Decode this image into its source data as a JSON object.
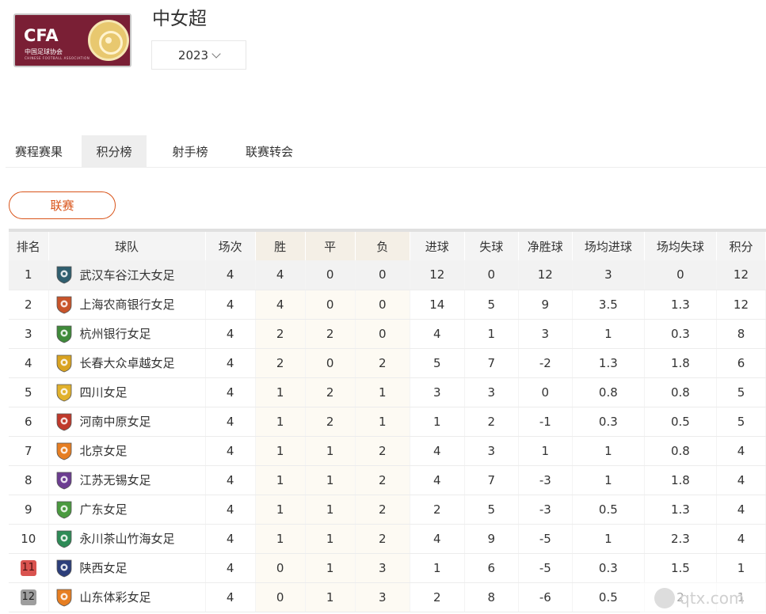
{
  "header": {
    "logo_text": "CFA",
    "logo_sub": "中国足球协会",
    "logo_sub_en": "CHINESE FOOTBALL ASSOCIATION",
    "title": "中女超",
    "season": "2023"
  },
  "tabs": [
    {
      "label": "赛程赛果",
      "active": false
    },
    {
      "label": "积分榜",
      "active": true
    },
    {
      "label": "射手榜",
      "active": false
    },
    {
      "label": "联赛转会",
      "active": false
    }
  ],
  "filter": {
    "label": "联赛"
  },
  "table": {
    "headers": [
      "排名",
      "球队",
      "场次",
      "胜",
      "平",
      "负",
      "进球",
      "失球",
      "净胜球",
      "场均进球",
      "场均失球",
      "积分"
    ],
    "rows": [
      {
        "rank": "1",
        "team": "武汉车谷江大女足",
        "played": "4",
        "w": "4",
        "d": "0",
        "l": "0",
        "gf": "12",
        "ga": "0",
        "gd": "12",
        "avg_gf": "3",
        "avg_ga": "0",
        "pts": "12",
        "badge": "wuhan-badge",
        "color": "#2f5e6e",
        "zone": ""
      },
      {
        "rank": "2",
        "team": "上海农商银行女足",
        "played": "4",
        "w": "4",
        "d": "0",
        "l": "0",
        "gf": "14",
        "ga": "5",
        "gd": "9",
        "avg_gf": "3.5",
        "avg_ga": "1.3",
        "pts": "12",
        "badge": "shanghai-badge",
        "color": "#c8542a",
        "zone": ""
      },
      {
        "rank": "3",
        "team": "杭州银行女足",
        "played": "4",
        "w": "2",
        "d": "2",
        "l": "0",
        "gf": "4",
        "ga": "1",
        "gd": "3",
        "avg_gf": "1",
        "avg_ga": "0.3",
        "pts": "8",
        "badge": "hangzhou-badge",
        "color": "#3f8a3a",
        "zone": ""
      },
      {
        "rank": "4",
        "team": "长春大众卓越女足",
        "played": "4",
        "w": "2",
        "d": "0",
        "l": "2",
        "gf": "5",
        "ga": "7",
        "gd": "-2",
        "avg_gf": "1.3",
        "avg_ga": "1.8",
        "pts": "6",
        "badge": "changchun-badge",
        "color": "#d9a321",
        "zone": ""
      },
      {
        "rank": "5",
        "team": "四川女足",
        "played": "4",
        "w": "1",
        "d": "2",
        "l": "1",
        "gf": "3",
        "ga": "3",
        "gd": "0",
        "avg_gf": "0.8",
        "avg_ga": "0.8",
        "pts": "5",
        "badge": "sichuan-badge",
        "color": "#e1b12c",
        "zone": ""
      },
      {
        "rank": "6",
        "team": "河南中原女足",
        "played": "4",
        "w": "1",
        "d": "2",
        "l": "1",
        "gf": "1",
        "ga": "2",
        "gd": "-1",
        "avg_gf": "0.3",
        "avg_ga": "0.5",
        "pts": "5",
        "badge": "henan-badge",
        "color": "#c0392b",
        "zone": ""
      },
      {
        "rank": "7",
        "team": "北京女足",
        "played": "4",
        "w": "1",
        "d": "1",
        "l": "2",
        "gf": "4",
        "ga": "3",
        "gd": "1",
        "avg_gf": "1",
        "avg_ga": "0.8",
        "pts": "4",
        "badge": "beijing-badge",
        "color": "#e67e22",
        "zone": ""
      },
      {
        "rank": "8",
        "team": "江苏无锡女足",
        "played": "4",
        "w": "1",
        "d": "1",
        "l": "2",
        "gf": "4",
        "ga": "7",
        "gd": "-3",
        "avg_gf": "1",
        "avg_ga": "1.8",
        "pts": "4",
        "badge": "jiangsu-badge",
        "color": "#6c3d91",
        "zone": ""
      },
      {
        "rank": "9",
        "team": "广东女足",
        "played": "4",
        "w": "1",
        "d": "1",
        "l": "2",
        "gf": "2",
        "ga": "5",
        "gd": "-3",
        "avg_gf": "0.5",
        "avg_ga": "1.3",
        "pts": "4",
        "badge": "guangdong-badge",
        "color": "#4a9a3f",
        "zone": ""
      },
      {
        "rank": "10",
        "team": "永川茶山竹海女足",
        "played": "4",
        "w": "1",
        "d": "1",
        "l": "2",
        "gf": "4",
        "ga": "9",
        "gd": "-5",
        "avg_gf": "1",
        "avg_ga": "2.3",
        "pts": "4",
        "badge": "yongchuan-badge",
        "color": "#2e8b57",
        "zone": ""
      },
      {
        "rank": "11",
        "team": "陕西女足",
        "played": "4",
        "w": "0",
        "d": "1",
        "l": "3",
        "gf": "1",
        "ga": "6",
        "gd": "-5",
        "avg_gf": "0.3",
        "avg_ga": "1.5",
        "pts": "1",
        "badge": "shaanxi-badge",
        "color": "#2c3e7a",
        "zone": "relegation"
      },
      {
        "rank": "12",
        "team": "山东体彩女足",
        "played": "4",
        "w": "0",
        "d": "1",
        "l": "3",
        "gf": "2",
        "ga": "8",
        "gd": "-6",
        "avg_gf": "0.5",
        "avg_ga": "2",
        "pts": "1",
        "badge": "shandong-badge",
        "color": "#e67e22",
        "zone": "playoff"
      }
    ]
  },
  "watermark": {
    "text": "qtx.com"
  },
  "colors": {
    "accent": "#d9541a",
    "logo_bg": "#7a1f35",
    "relegation": "#d9534f",
    "playoff": "#9e9e9e"
  }
}
